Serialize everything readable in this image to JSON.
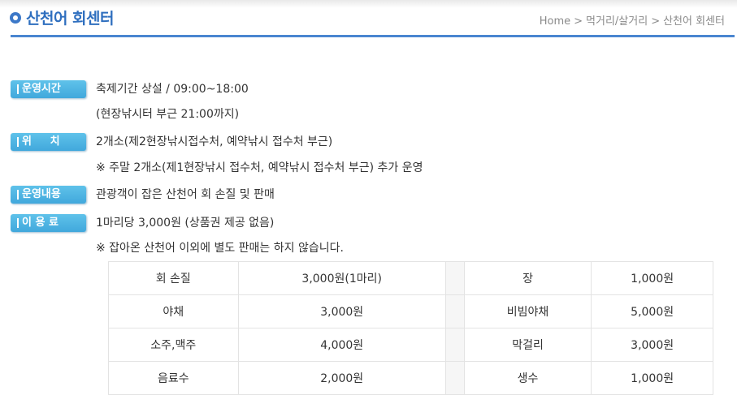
{
  "page": {
    "title": "산천어 회센터",
    "breadcrumb": [
      "Home",
      "먹거리/살거리",
      "산천어 회센터"
    ],
    "breadcrumb_sep": ">"
  },
  "info": [
    {
      "label": "운영시간",
      "lines": [
        "축제기간 상설 / 09:00~18:00",
        "(현장낚시터 부근 21:00까지)"
      ]
    },
    {
      "label": "위     치",
      "lines": [
        "2개소(제2현장낚시접수처, 예약낚시 접수처 부근)",
        "※ 주말 2개소(제1현장낚시 접수처, 예약낚시 접수처 부근) 추가 운영"
      ]
    },
    {
      "label": "운영내용",
      "lines": [
        "관광객이 잡은 산천어 회 손질 및 판매"
      ]
    },
    {
      "label": "이 용 료",
      "lines": [
        "1마리당 3,000원 (상품권 제공 없음)",
        "※ 잡아온 산천어 이외에 별도 판매는 하지 않습니다."
      ]
    }
  ],
  "prices": [
    {
      "left_item": "회 손질",
      "left_price": "3,000원(1마리)",
      "right_item": "장",
      "right_price": "1,000원"
    },
    {
      "left_item": "야채",
      "left_price": "3,000원",
      "right_item": "비빔야채",
      "right_price": "5,000원"
    },
    {
      "left_item": "소주,맥주",
      "left_price": "4,000원",
      "right_item": "막걸리",
      "right_price": "3,000원"
    },
    {
      "left_item": "음료수",
      "left_price": "2,000원",
      "right_item": "생수",
      "right_price": "1,000원"
    }
  ],
  "colors": {
    "accent": "#2f6fbf",
    "badge": "#4fb6e4",
    "rule": "#4a86d0"
  }
}
